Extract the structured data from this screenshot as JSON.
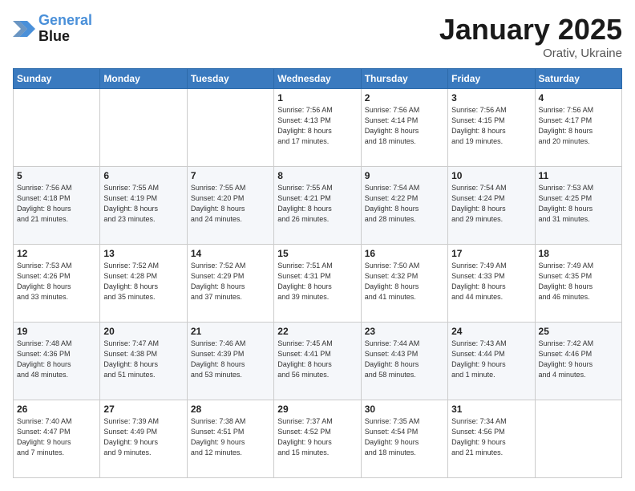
{
  "header": {
    "logo_line1": "General",
    "logo_line2": "Blue",
    "month": "January 2025",
    "location": "Orativ, Ukraine"
  },
  "weekdays": [
    "Sunday",
    "Monday",
    "Tuesday",
    "Wednesday",
    "Thursday",
    "Friday",
    "Saturday"
  ],
  "weeks": [
    [
      {
        "day": "",
        "info": ""
      },
      {
        "day": "",
        "info": ""
      },
      {
        "day": "",
        "info": ""
      },
      {
        "day": "1",
        "info": "Sunrise: 7:56 AM\nSunset: 4:13 PM\nDaylight: 8 hours\nand 17 minutes."
      },
      {
        "day": "2",
        "info": "Sunrise: 7:56 AM\nSunset: 4:14 PM\nDaylight: 8 hours\nand 18 minutes."
      },
      {
        "day": "3",
        "info": "Sunrise: 7:56 AM\nSunset: 4:15 PM\nDaylight: 8 hours\nand 19 minutes."
      },
      {
        "day": "4",
        "info": "Sunrise: 7:56 AM\nSunset: 4:17 PM\nDaylight: 8 hours\nand 20 minutes."
      }
    ],
    [
      {
        "day": "5",
        "info": "Sunrise: 7:56 AM\nSunset: 4:18 PM\nDaylight: 8 hours\nand 21 minutes."
      },
      {
        "day": "6",
        "info": "Sunrise: 7:55 AM\nSunset: 4:19 PM\nDaylight: 8 hours\nand 23 minutes."
      },
      {
        "day": "7",
        "info": "Sunrise: 7:55 AM\nSunset: 4:20 PM\nDaylight: 8 hours\nand 24 minutes."
      },
      {
        "day": "8",
        "info": "Sunrise: 7:55 AM\nSunset: 4:21 PM\nDaylight: 8 hours\nand 26 minutes."
      },
      {
        "day": "9",
        "info": "Sunrise: 7:54 AM\nSunset: 4:22 PM\nDaylight: 8 hours\nand 28 minutes."
      },
      {
        "day": "10",
        "info": "Sunrise: 7:54 AM\nSunset: 4:24 PM\nDaylight: 8 hours\nand 29 minutes."
      },
      {
        "day": "11",
        "info": "Sunrise: 7:53 AM\nSunset: 4:25 PM\nDaylight: 8 hours\nand 31 minutes."
      }
    ],
    [
      {
        "day": "12",
        "info": "Sunrise: 7:53 AM\nSunset: 4:26 PM\nDaylight: 8 hours\nand 33 minutes."
      },
      {
        "day": "13",
        "info": "Sunrise: 7:52 AM\nSunset: 4:28 PM\nDaylight: 8 hours\nand 35 minutes."
      },
      {
        "day": "14",
        "info": "Sunrise: 7:52 AM\nSunset: 4:29 PM\nDaylight: 8 hours\nand 37 minutes."
      },
      {
        "day": "15",
        "info": "Sunrise: 7:51 AM\nSunset: 4:31 PM\nDaylight: 8 hours\nand 39 minutes."
      },
      {
        "day": "16",
        "info": "Sunrise: 7:50 AM\nSunset: 4:32 PM\nDaylight: 8 hours\nand 41 minutes."
      },
      {
        "day": "17",
        "info": "Sunrise: 7:49 AM\nSunset: 4:33 PM\nDaylight: 8 hours\nand 44 minutes."
      },
      {
        "day": "18",
        "info": "Sunrise: 7:49 AM\nSunset: 4:35 PM\nDaylight: 8 hours\nand 46 minutes."
      }
    ],
    [
      {
        "day": "19",
        "info": "Sunrise: 7:48 AM\nSunset: 4:36 PM\nDaylight: 8 hours\nand 48 minutes."
      },
      {
        "day": "20",
        "info": "Sunrise: 7:47 AM\nSunset: 4:38 PM\nDaylight: 8 hours\nand 51 minutes."
      },
      {
        "day": "21",
        "info": "Sunrise: 7:46 AM\nSunset: 4:39 PM\nDaylight: 8 hours\nand 53 minutes."
      },
      {
        "day": "22",
        "info": "Sunrise: 7:45 AM\nSunset: 4:41 PM\nDaylight: 8 hours\nand 56 minutes."
      },
      {
        "day": "23",
        "info": "Sunrise: 7:44 AM\nSunset: 4:43 PM\nDaylight: 8 hours\nand 58 minutes."
      },
      {
        "day": "24",
        "info": "Sunrise: 7:43 AM\nSunset: 4:44 PM\nDaylight: 9 hours\nand 1 minute."
      },
      {
        "day": "25",
        "info": "Sunrise: 7:42 AM\nSunset: 4:46 PM\nDaylight: 9 hours\nand 4 minutes."
      }
    ],
    [
      {
        "day": "26",
        "info": "Sunrise: 7:40 AM\nSunset: 4:47 PM\nDaylight: 9 hours\nand 7 minutes."
      },
      {
        "day": "27",
        "info": "Sunrise: 7:39 AM\nSunset: 4:49 PM\nDaylight: 9 hours\nand 9 minutes."
      },
      {
        "day": "28",
        "info": "Sunrise: 7:38 AM\nSunset: 4:51 PM\nDaylight: 9 hours\nand 12 minutes."
      },
      {
        "day": "29",
        "info": "Sunrise: 7:37 AM\nSunset: 4:52 PM\nDaylight: 9 hours\nand 15 minutes."
      },
      {
        "day": "30",
        "info": "Sunrise: 7:35 AM\nSunset: 4:54 PM\nDaylight: 9 hours\nand 18 minutes."
      },
      {
        "day": "31",
        "info": "Sunrise: 7:34 AM\nSunset: 4:56 PM\nDaylight: 9 hours\nand 21 minutes."
      },
      {
        "day": "",
        "info": ""
      }
    ]
  ]
}
